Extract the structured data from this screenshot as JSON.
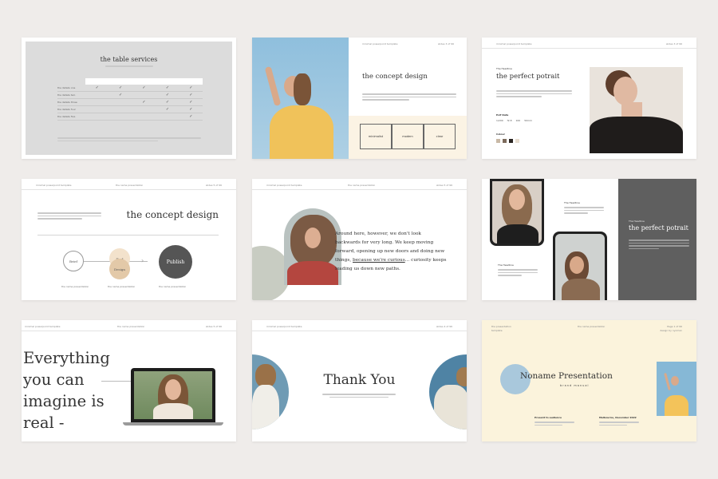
{
  "slides": {
    "s1": {
      "title": "the table services",
      "rows": [
        "the details one",
        "the details two",
        "the details three",
        "the details four",
        "the details five"
      ],
      "checks": [
        [
          1,
          1,
          1,
          1,
          1
        ],
        [
          0,
          1,
          0,
          1,
          1
        ],
        [
          0,
          0,
          1,
          1,
          1
        ],
        [
          0,
          0,
          0,
          1,
          1
        ],
        [
          0,
          0,
          0,
          0,
          1
        ]
      ]
    },
    "s2": {
      "header_left": "minimal powerpoint template",
      "header_right": "slides 3 of 96",
      "title": "the concept design",
      "box1": "minimalist",
      "box2": "modern",
      "box3": "clear"
    },
    "s3": {
      "header_left": "minimal powerpoint template",
      "header_right": "slides 3 of 96",
      "eyebrow": "The Headline",
      "title": "the perfect potrait",
      "exif_label": "Exif Data",
      "exif_values": [
        "1/200",
        "f2.8",
        "100",
        "50mm"
      ],
      "colour_label": "Colour",
      "swatches": [
        "#c9b9a6",
        "#7d6b5c",
        "#2b2522",
        "#e7ddd0"
      ]
    },
    "s4": {
      "header_left": "minimal powerpoint template",
      "header_mid": "the name presentation",
      "header_right": "slides 5 of 96",
      "title": "the concept design",
      "node1": "Brief",
      "node2a": "Find",
      "node2b": "Design",
      "node3": "Publish",
      "cap1": "the name presentation",
      "cap2": "the name presentation",
      "cap3": "the name presentation"
    },
    "s5": {
      "header_left": "minimal powerpoint template",
      "header_mid": "the name presentation",
      "header_right": "slides 5 of 96",
      "quote_before": "Around here, however, we don't look backwards for very long. We keep moving forward, opening up new doors and doing new things, ",
      "quote_link": "because we're curious",
      "quote_after": "... curiosity keeps leading us down new paths."
    },
    "s6": {
      "label_top": "The Headline",
      "label_bottom": "The Headline",
      "panel_eyebrow": "The Headline",
      "panel_title": "the perfect potrait"
    },
    "s7": {
      "header_left": "minimal powerpoint template",
      "header_mid": "the name presentation",
      "header_right": "slides 5 of 96",
      "headline": [
        "Everything",
        "you can",
        "imagine is",
        "real -"
      ]
    },
    "s8": {
      "header_left": "minimal powerpoint template",
      "header_right": "slides 4 of 96",
      "title": "Thank You"
    },
    "s9": {
      "header_left": "the presentation",
      "header_left2": "template",
      "header_mid": "the name presentation",
      "header_right": "Page 1 of 96",
      "header_right2": "design by nyoman",
      "title": "Noname Presentation",
      "subtitle": "brand manual",
      "col1_title": "Present to audience",
      "col2_title": "Melbourne, December 2022"
    }
  },
  "colors": {
    "background": "#efecea",
    "cream": "#fbf3dc",
    "dark_panel": "#5f5f5f",
    "sage": "#c8ccc2",
    "beige_circle": "#e3c9a8",
    "sky": "#8cb7cf",
    "mustard": "#f3c35a"
  }
}
